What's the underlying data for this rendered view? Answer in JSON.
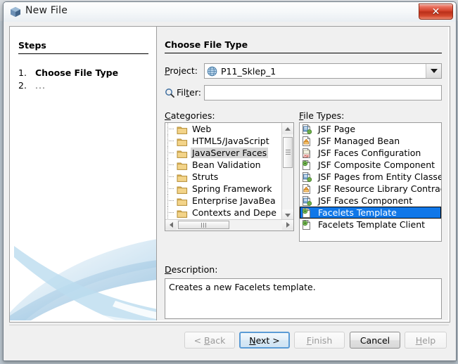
{
  "window": {
    "title": "New File",
    "icon": "netbeans-cube-icon",
    "close_label": "✕"
  },
  "steps": {
    "heading": "Steps",
    "items": [
      {
        "number": "1.",
        "label": "Choose File Type",
        "current": true
      },
      {
        "number": "2.",
        "label": "...",
        "current": false
      }
    ]
  },
  "main": {
    "heading": "Choose File Type",
    "project": {
      "label": "Project:",
      "mnemonic": "P",
      "rest": "roject:",
      "icon": "globe-icon",
      "value": "P11_Sklep_1",
      "arrow": "chevron-down-icon"
    },
    "filter": {
      "label": "Filter:",
      "label_pre": "Fil",
      "label_mn": "t",
      "label_post": "er:",
      "icon": "search-icon",
      "value": "",
      "placeholder": ""
    },
    "categories": {
      "label": "Categories:",
      "label_mn": "C",
      "label_rest": "ategories:",
      "items": [
        {
          "label": "Web",
          "selected": false
        },
        {
          "label": "HTML5/JavaScript",
          "selected": false
        },
        {
          "label": "JavaServer Faces",
          "selected": true
        },
        {
          "label": "Bean Validation",
          "selected": false
        },
        {
          "label": "Struts",
          "selected": false
        },
        {
          "label": "Spring Framework",
          "selected": false
        },
        {
          "label": "Enterprise JavaBea",
          "selected": false
        },
        {
          "label": "Contexts and Depe",
          "selected": false
        }
      ]
    },
    "file_types": {
      "label": "File Types:",
      "label_mn": "F",
      "label_rest": "ile Types:",
      "items": [
        {
          "label": "JSF Page",
          "icon": "jsf-page-icon",
          "selected": false
        },
        {
          "label": "JSF Managed Bean",
          "icon": "jsf-bean-icon",
          "selected": false
        },
        {
          "label": "JSF Faces Configuration",
          "icon": "jsf-config-icon",
          "selected": false
        },
        {
          "label": "JSF Composite Component",
          "icon": "jsf-composite-icon",
          "selected": false
        },
        {
          "label": "JSF Pages from Entity Classes",
          "icon": "jsf-page-icon",
          "selected": false
        },
        {
          "label": "JSF Resource Library Contract",
          "icon": "jsf-bean-icon",
          "selected": false
        },
        {
          "label": "JSF Faces Component",
          "icon": "jsf-page-icon",
          "selected": false
        },
        {
          "label": "Facelets Template",
          "icon": "jsf-composite-icon",
          "selected": true
        },
        {
          "label": "Facelets Template Client",
          "icon": "jsf-composite-icon",
          "selected": false
        }
      ]
    },
    "description": {
      "label": "Description:",
      "label_mn": "D",
      "label_rest": "escription:",
      "text": "Creates a new Facelets template."
    }
  },
  "buttons": [
    {
      "id": "back",
      "label": "< Back",
      "mn": "B",
      "pre": "< ",
      "post": "ack",
      "state": "disabled"
    },
    {
      "id": "next",
      "label": "Next >",
      "mn": "N",
      "pre": "",
      "post": "ext >",
      "state": "default"
    },
    {
      "id": "finish",
      "label": "Finish",
      "mn": "F",
      "pre": "",
      "post": "inish",
      "state": "disabled"
    },
    {
      "id": "cancel",
      "label": "Cancel",
      "mn": "",
      "pre": "Cancel",
      "post": "",
      "state": "normal"
    },
    {
      "id": "help",
      "label": "Help",
      "mn": "H",
      "pre": "",
      "post": "elp",
      "state": "disabled"
    }
  ],
  "colors": {
    "selection_blue": "#1077e8",
    "selection_gray": "#d6d6d6",
    "dialog_bg": "#f0f0f0",
    "default_button_border": "#5b9bd5",
    "close_red": "#cf3a22"
  }
}
